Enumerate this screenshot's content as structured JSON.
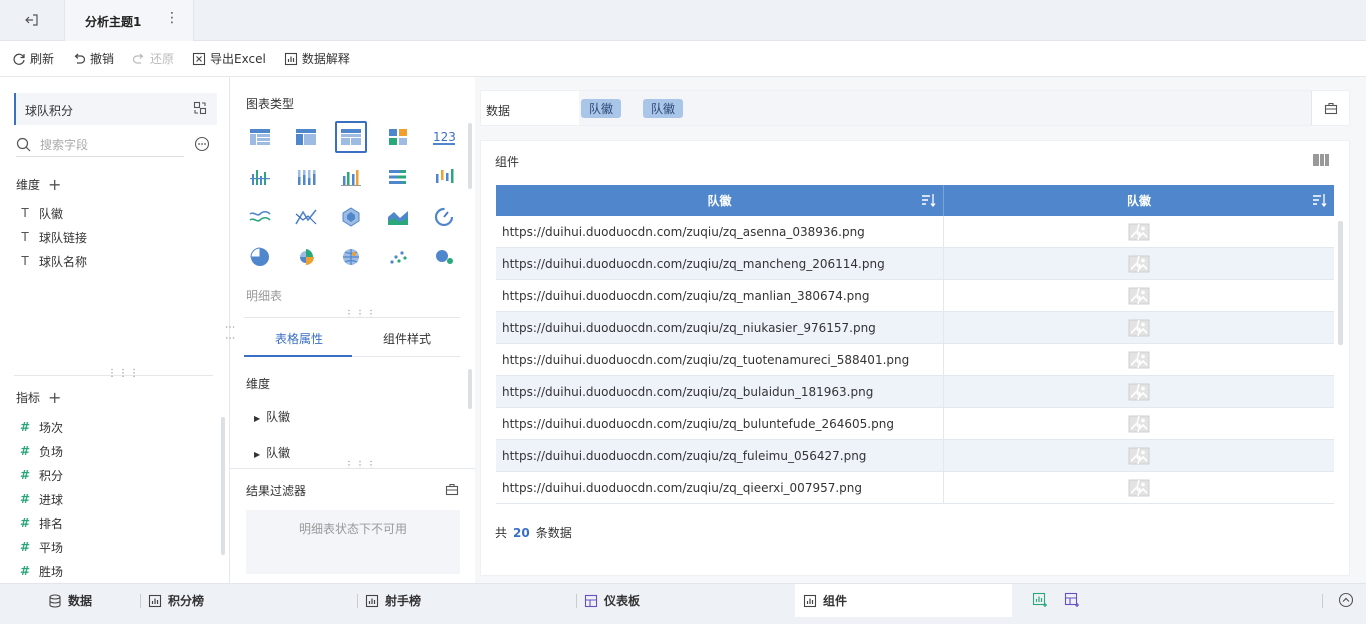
{
  "topbar": {
    "tab_title": "分析主题1",
    "more": "⋮"
  },
  "toolbar": {
    "refresh": "刷新",
    "undo": "撤销",
    "redo": "还原",
    "export": "导出Excel",
    "explain": "数据解释"
  },
  "left": {
    "dataset": "球队积分",
    "search_placeholder": "搜索字段",
    "dimensions_title": "维度",
    "dimensions": [
      "队徽",
      "球队链接",
      "球队名称"
    ],
    "measures_title": "指标",
    "measures": [
      "场次",
      "负场",
      "积分",
      "进球",
      "排名",
      "平场",
      "胜场"
    ]
  },
  "middle": {
    "chart_type_title": "图表类型",
    "chart_type_name": "明细表",
    "tab_table": "表格属性",
    "tab_style": "组件样式",
    "dim_title": "维度",
    "dim_items": [
      "队徽",
      "队徽"
    ],
    "filter_title": "结果过滤器",
    "filter_disabled": "明细表状态下不可用"
  },
  "right": {
    "data_label": "数据",
    "pills": [
      "队徽",
      "队徽"
    ],
    "component_title": "组件",
    "columns": [
      "队徽",
      "队徽"
    ],
    "rows": [
      "https://duihui.duoduocdn.com/zuqiu/zq_asenna_038936.png",
      "https://duihui.duoduocdn.com/zuqiu/zq_mancheng_206114.png",
      "https://duihui.duoduocdn.com/zuqiu/zq_manlian_380674.png",
      "https://duihui.duoduocdn.com/zuqiu/zq_niukasier_976157.png",
      "https://duihui.duoduocdn.com/zuqiu/zq_tuotenamureci_588401.png",
      "https://duihui.duoduocdn.com/zuqiu/zq_bulaidun_181963.png",
      "https://duihui.duoduocdn.com/zuqiu/zq_buluntefude_264605.png",
      "https://duihui.duoduocdn.com/zuqiu/zq_fuleimu_056427.png",
      "https://duihui.duoduocdn.com/zuqiu/zq_qieerxi_007957.png"
    ],
    "total_prefix": "共",
    "total_count": "20",
    "total_suffix": "条数据"
  },
  "bottom": {
    "tabs": [
      "数据",
      "积分榜",
      "射手榜",
      "仪表板",
      "组件"
    ]
  },
  "colors": {
    "accent": "#3b6fc4",
    "header": "#4f86cc",
    "measure": "#2aa87a"
  }
}
